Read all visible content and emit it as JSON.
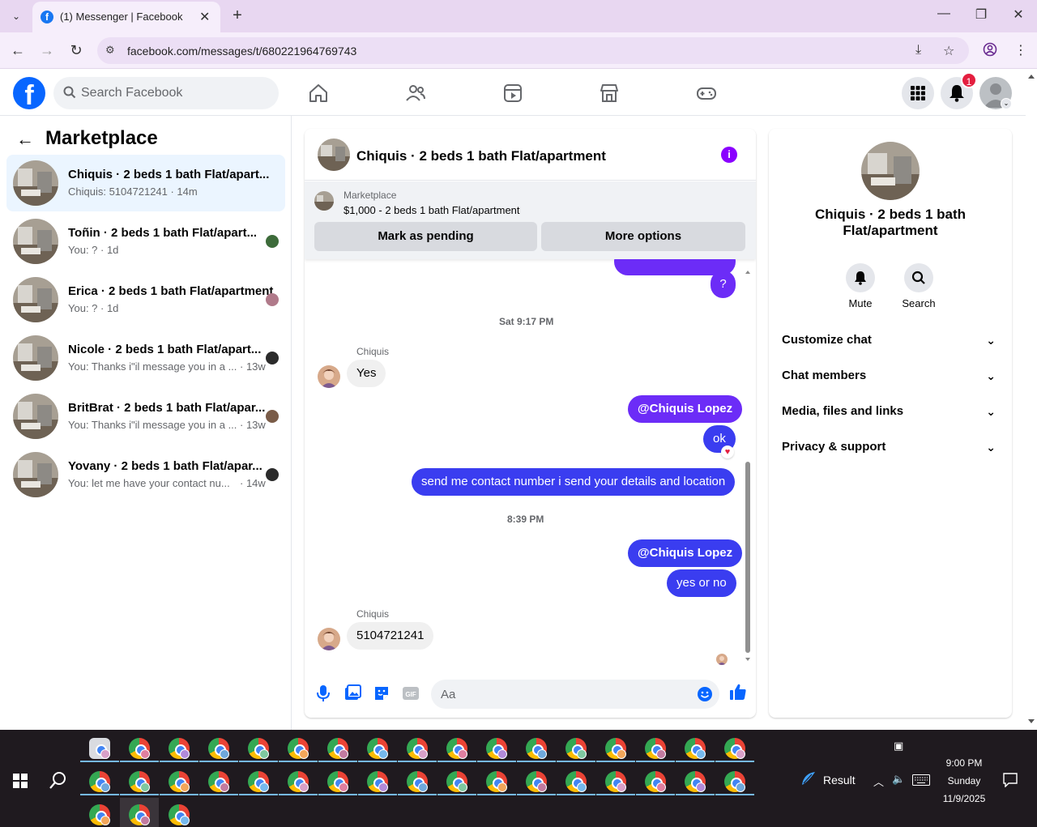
{
  "browser": {
    "tab_title": "(1) Messenger | Facebook",
    "url": "facebook.com/messages/t/680221964769743"
  },
  "header": {
    "search_placeholder": "Search Facebook",
    "notification_count": "1"
  },
  "sidebar": {
    "title": "Marketplace",
    "conversations": [
      {
        "name": "Chiquis · 2 beds 1 bath Flat/apart...",
        "preview": "Chiquis: 5104721241 · 14m",
        "time": ""
      },
      {
        "name": "Toñin · 2 beds 1 bath Flat/apart...",
        "preview": "You: ? · 1d",
        "time": ""
      },
      {
        "name": "Erica · 2 beds 1 bath Flat/apartment",
        "preview": "You: ? · 1d",
        "time": ""
      },
      {
        "name": "Nicole · 2 beds 1 bath Flat/apart...",
        "preview": "You: Thanks i\"il message you in a ...",
        "time": "· 13w"
      },
      {
        "name": "BritBrat · 2 beds 1 bath Flat/apar...",
        "preview": "You: Thanks i\"il message you in a ...",
        "time": "· 13w"
      },
      {
        "name": "Yovany · 2 beds 1 bath Flat/apar...",
        "preview": "You: let me have your contact nu...",
        "time": "· 14w"
      }
    ]
  },
  "chat": {
    "title": "Chiquis · 2 beds 1 bath Flat/apartment",
    "marketplace_label": "Marketplace",
    "listing": "$1,000 - 2 beds 1 bath Flat/apartment",
    "mark_pending": "Mark as pending",
    "more_options": "More options",
    "messages": {
      "q": "?",
      "stamp1": "Sat 9:17 PM",
      "sender1": "Chiquis",
      "yes": "Yes",
      "mention1": "@Chiquis Lopez",
      "ok": "ok",
      "send_contact": "send me contact number i send your details and location",
      "stamp2": "8:39 PM",
      "mention2": "@Chiquis Lopez",
      "yes_or_no": "yes or no",
      "sender2": "Chiquis",
      "phone": "5104721241"
    },
    "composer_placeholder": "Aa"
  },
  "details": {
    "name": "Chiquis · 2 beds 1 bath Flat/apartment",
    "mute": "Mute",
    "search": "Search",
    "rows": [
      "Customize chat",
      "Chat members",
      "Media, files and links",
      "Privacy & support"
    ]
  },
  "taskbar": {
    "result_label": "Result",
    "time": "9:00 PM",
    "day": "Sunday",
    "date": "11/9/2025"
  }
}
